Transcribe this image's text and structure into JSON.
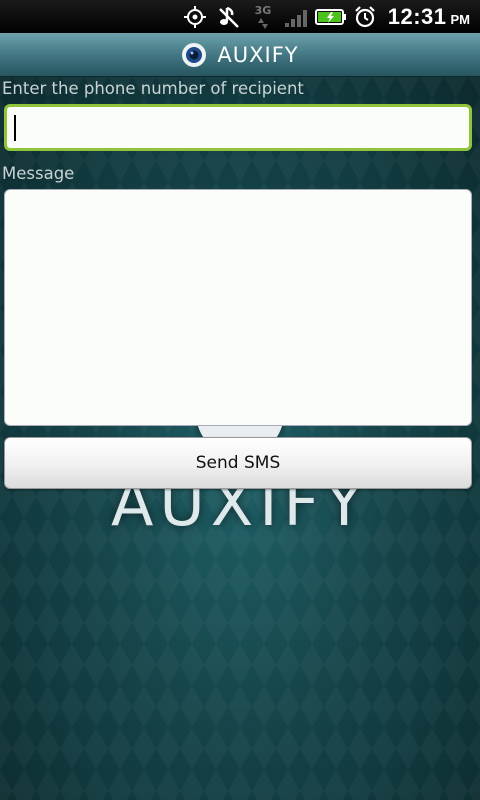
{
  "status_bar": {
    "time": "12:31",
    "ampm": "PM",
    "network": "3G",
    "icons": [
      "gps-icon",
      "mute-icon",
      "network-3g-icon",
      "signal-icon",
      "battery-icon",
      "alarm-icon"
    ]
  },
  "app": {
    "title": "AUXIFY",
    "watermark": "AUXIFY"
  },
  "form": {
    "phone_label": "Enter the phone number of recipient",
    "phone_value": "",
    "message_label": "Message",
    "message_value": "",
    "send_label": "Send SMS"
  },
  "colors": {
    "accent_focus": "#8fc43b",
    "title_bar": "#3f7480",
    "background": "#154449"
  }
}
